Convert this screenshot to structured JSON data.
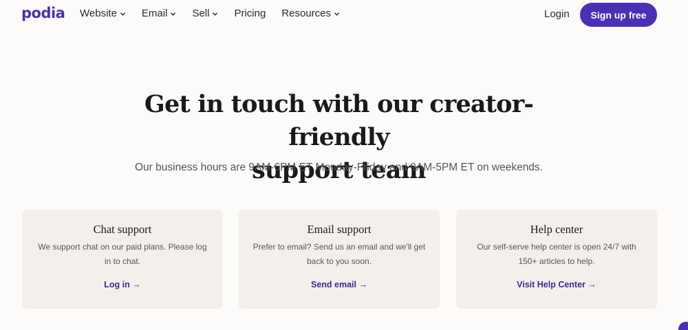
{
  "header": {
    "logo": "podia",
    "nav": [
      {
        "label": "Website",
        "dropdown": true
      },
      {
        "label": "Email",
        "dropdown": true
      },
      {
        "label": "Sell",
        "dropdown": true
      },
      {
        "label": "Pricing",
        "dropdown": false
      },
      {
        "label": "Resources",
        "dropdown": true
      }
    ],
    "login": "Login",
    "signup": "Sign up free"
  },
  "hero": {
    "title_line1": "Get in touch with our creator-friendly",
    "title_line2": "support team",
    "subtitle": "Our business hours are 9AM-6PM ET Monday-Friday and 9AM-5PM ET on weekends."
  },
  "cards": [
    {
      "title": "Chat support",
      "desc": "We support chat on our paid plans. Please log in to chat.",
      "link": "Log in →"
    },
    {
      "title": "Email support",
      "desc": "Prefer to email? Send us an email and we'll get back to you soon.",
      "link": "Send email →"
    },
    {
      "title": "Help center",
      "desc": "Our self-serve help center is open 24/7 with 150+ articles to help.",
      "link": "Visit Help Center →"
    }
  ],
  "colors": {
    "brand": "#4b2fb5",
    "card_bg": "#f4efea",
    "page_bg": "#fcfbfa"
  }
}
